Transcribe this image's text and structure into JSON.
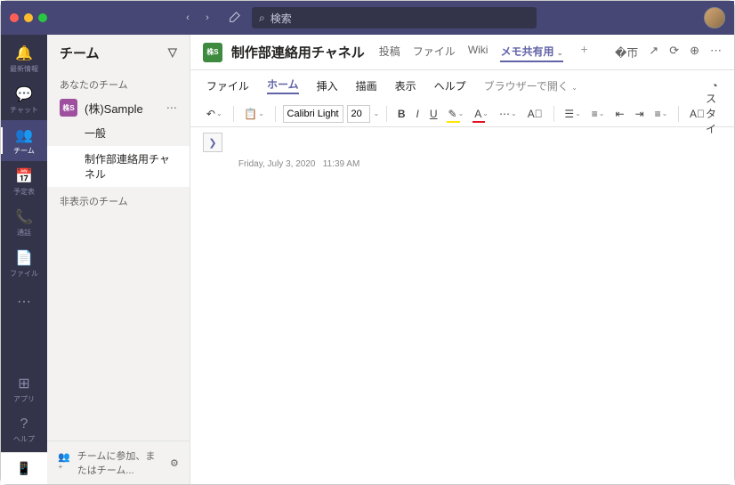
{
  "search": {
    "placeholder": "検索"
  },
  "rail": {
    "items": [
      {
        "icon": "bell",
        "label": "最新情報"
      },
      {
        "icon": "chat",
        "label": "チャット"
      },
      {
        "icon": "teams",
        "label": "チーム"
      },
      {
        "icon": "calendar",
        "label": "予定表"
      },
      {
        "icon": "call",
        "label": "通話"
      },
      {
        "icon": "file",
        "label": "ファイル"
      }
    ],
    "apps": "アプリ",
    "help": "ヘルプ"
  },
  "sidebar": {
    "title": "チーム",
    "your_teams": "あなたのチーム",
    "team_badge": "株S",
    "team_name": "(株)Sample",
    "channels": [
      "一般",
      "制作部連絡用チャネル"
    ],
    "hidden_teams": "非表示のチーム",
    "footer": "チームに参加、またはチーム..."
  },
  "content": {
    "badge": "株S",
    "title": "制作部連絡用チャネル",
    "tabs": [
      "投稿",
      "ファイル",
      "Wiki",
      "メモ共有用"
    ],
    "editor_menu": {
      "file": "ファイル",
      "home": "ホーム",
      "insert": "挿入",
      "draw": "描画",
      "view": "表示",
      "help": "ヘルプ",
      "browser": "ブラウザーで開く"
    },
    "font": "Calibri Light",
    "size": "20",
    "date": "Friday, July 3, 2020",
    "time": "11:39 AM",
    "style_label": "スタイ"
  }
}
